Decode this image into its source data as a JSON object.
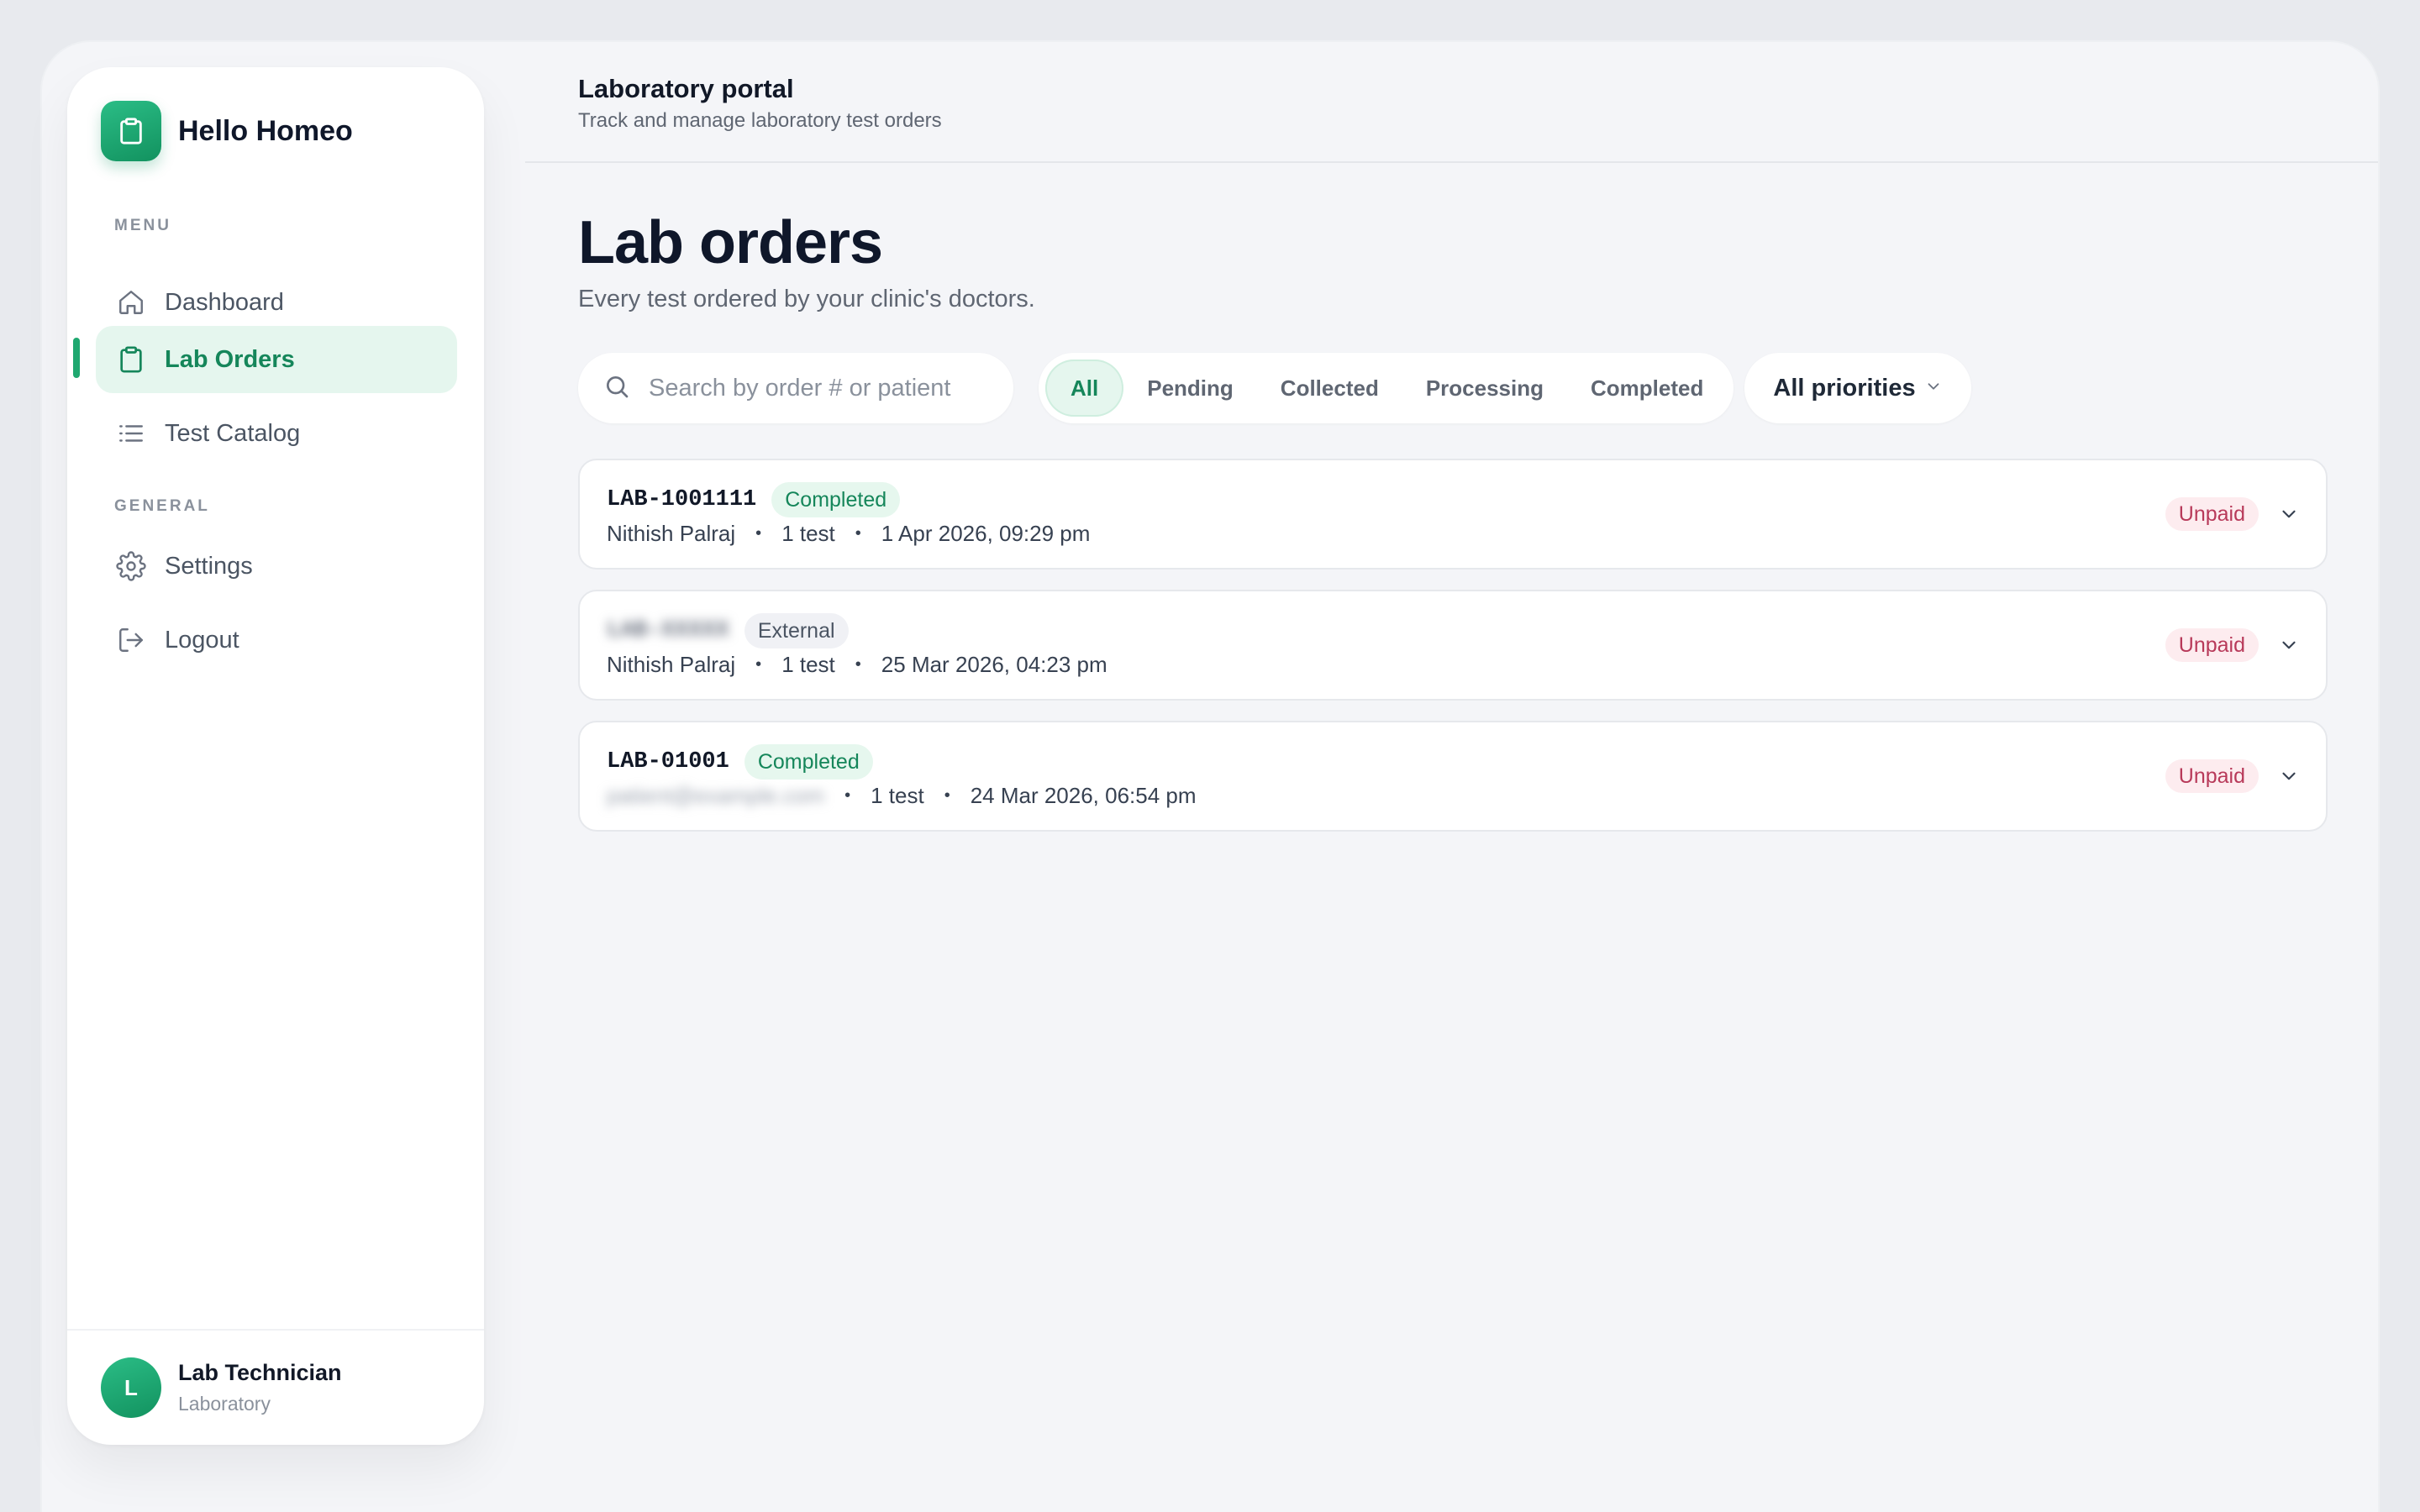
{
  "brand": {
    "name": "Hello Homeo",
    "logo_icon": "clipboard-icon",
    "accent": "#1fa870"
  },
  "sidebar": {
    "menu_label": "MENU",
    "general_label": "GENERAL",
    "menu_items": [
      {
        "label": "Dashboard",
        "icon": "home-icon",
        "active": false
      },
      {
        "label": "Lab Orders",
        "icon": "clipboard-icon",
        "active": true
      },
      {
        "label": "Test Catalog",
        "icon": "list-icon",
        "active": false
      }
    ],
    "general_items": [
      {
        "label": "Settings",
        "icon": "gear-icon"
      },
      {
        "label": "Logout",
        "icon": "logout-icon"
      }
    ],
    "user": {
      "initial": "L",
      "name": "Lab Technician",
      "role": "Laboratory"
    }
  },
  "header": {
    "title": "Laboratory portal",
    "subtitle": "Track and manage laboratory test orders"
  },
  "main": {
    "title": "Lab orders",
    "subtitle": "Every test ordered by your clinic's doctors.",
    "search": {
      "placeholder": "Search by order # or patient",
      "value": ""
    },
    "tabs": [
      "All",
      "Pending",
      "Collected",
      "Processing",
      "Completed"
    ],
    "active_tab": "All",
    "priority_filter": "All priorities"
  },
  "orders": [
    {
      "id": "LAB-1001111",
      "badge": "Completed",
      "badge_type": "completed",
      "id_blurred": false,
      "patient": "Nithish Palraj",
      "patient_blurred": false,
      "tests": "1 test",
      "date": "1 Apr 2026, 09:29 pm",
      "payment": "Unpaid"
    },
    {
      "id": "LAB-XXXXX",
      "badge": "External",
      "badge_type": "external",
      "id_blurred": true,
      "patient": "Nithish Palraj",
      "patient_blurred": false,
      "tests": "1 test",
      "date": "25 Mar 2026, 04:23 pm",
      "payment": "Unpaid"
    },
    {
      "id": "LAB-01001",
      "badge": "Completed",
      "badge_type": "completed",
      "id_blurred": false,
      "patient": "patient@example.com",
      "patient_blurred": true,
      "tests": "1 test",
      "date": "24 Mar 2026, 06:54 pm",
      "payment": "Unpaid"
    }
  ]
}
